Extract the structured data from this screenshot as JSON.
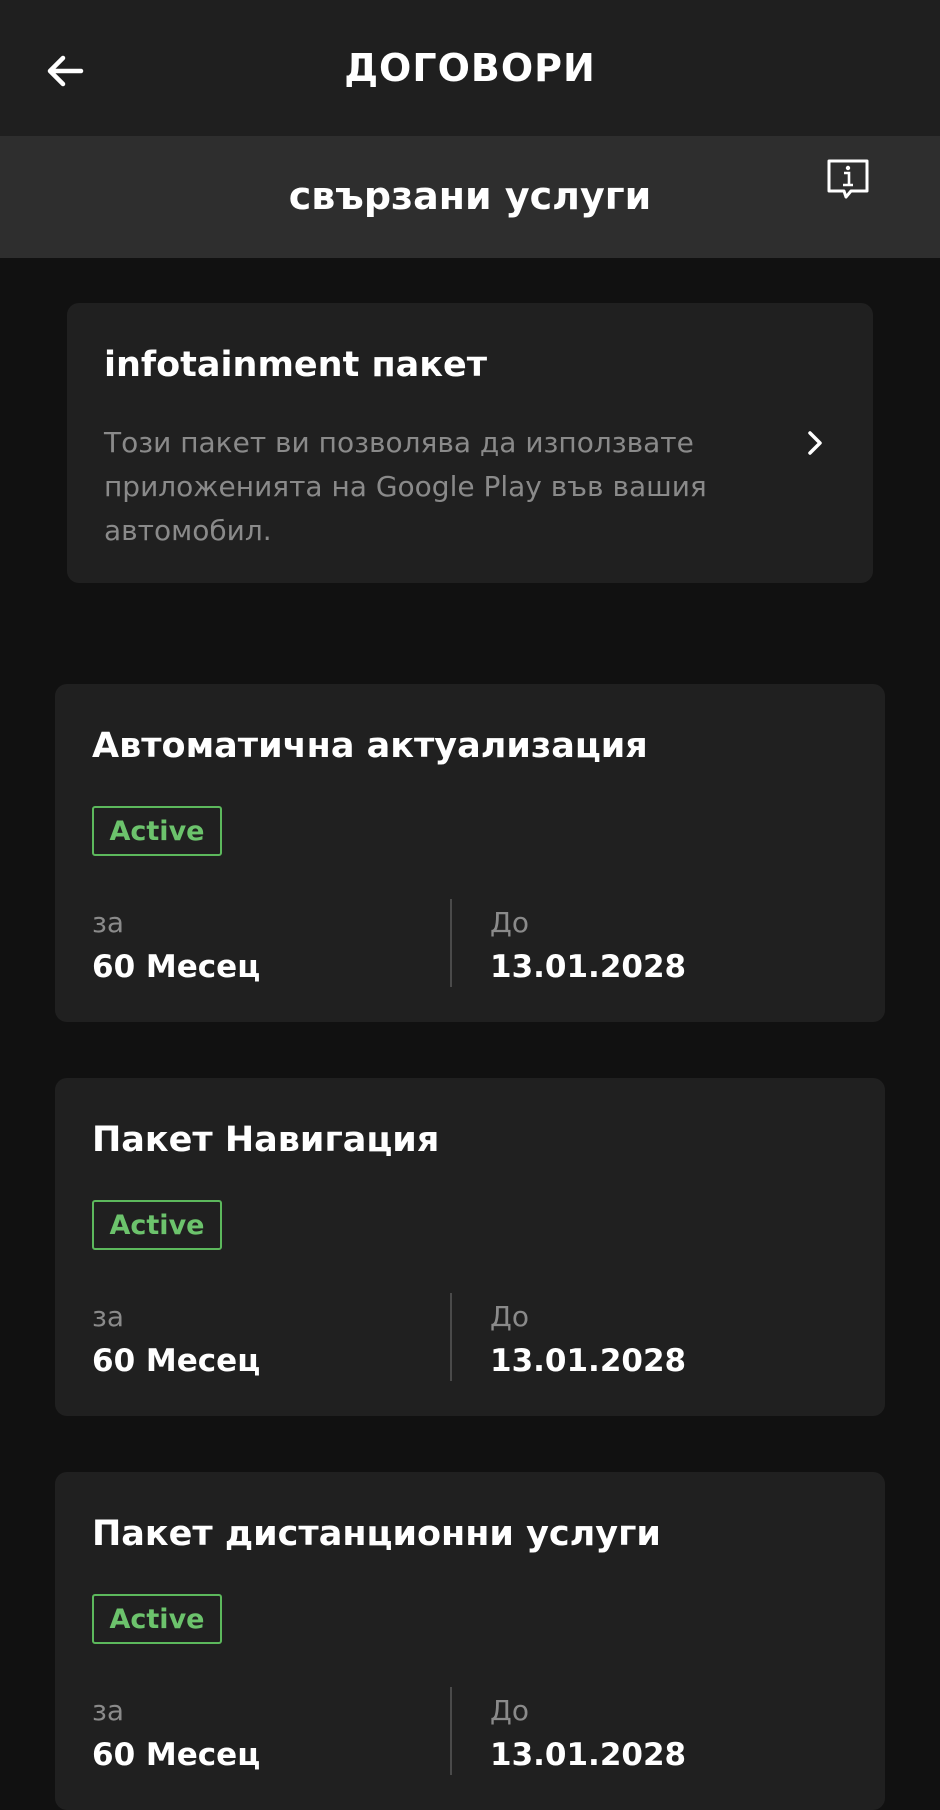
{
  "header": {
    "title": "ДОГОВОРИ",
    "back_icon": "arrow-left-icon"
  },
  "subheader": {
    "title": "свързани услуги",
    "info_icon": "info-message-icon"
  },
  "info_card": {
    "title": "infotainment пакет",
    "description": "Този пакет ви позволява да използвате приложенията на Google Play във вашия автомобил."
  },
  "services": [
    {
      "title": "Автоматична актуализация",
      "status": "Active",
      "duration_label": "за",
      "duration_value": "60 Месец",
      "end_label": "До",
      "end_value": "13.01.2028"
    },
    {
      "title": "Пакет Навигация",
      "status": "Active",
      "duration_label": "за",
      "duration_value": "60 Месец",
      "end_label": "До",
      "end_value": "13.01.2028"
    },
    {
      "title": "Пакет дистанционни услуги",
      "status": "Active",
      "duration_label": "за",
      "duration_value": "60 Месец",
      "end_label": "До",
      "end_value": "13.01.2028"
    }
  ],
  "colors": {
    "background": "#111111",
    "card": "#202020",
    "active_green": "#5cb85c",
    "muted_text": "#8a8a8a"
  }
}
